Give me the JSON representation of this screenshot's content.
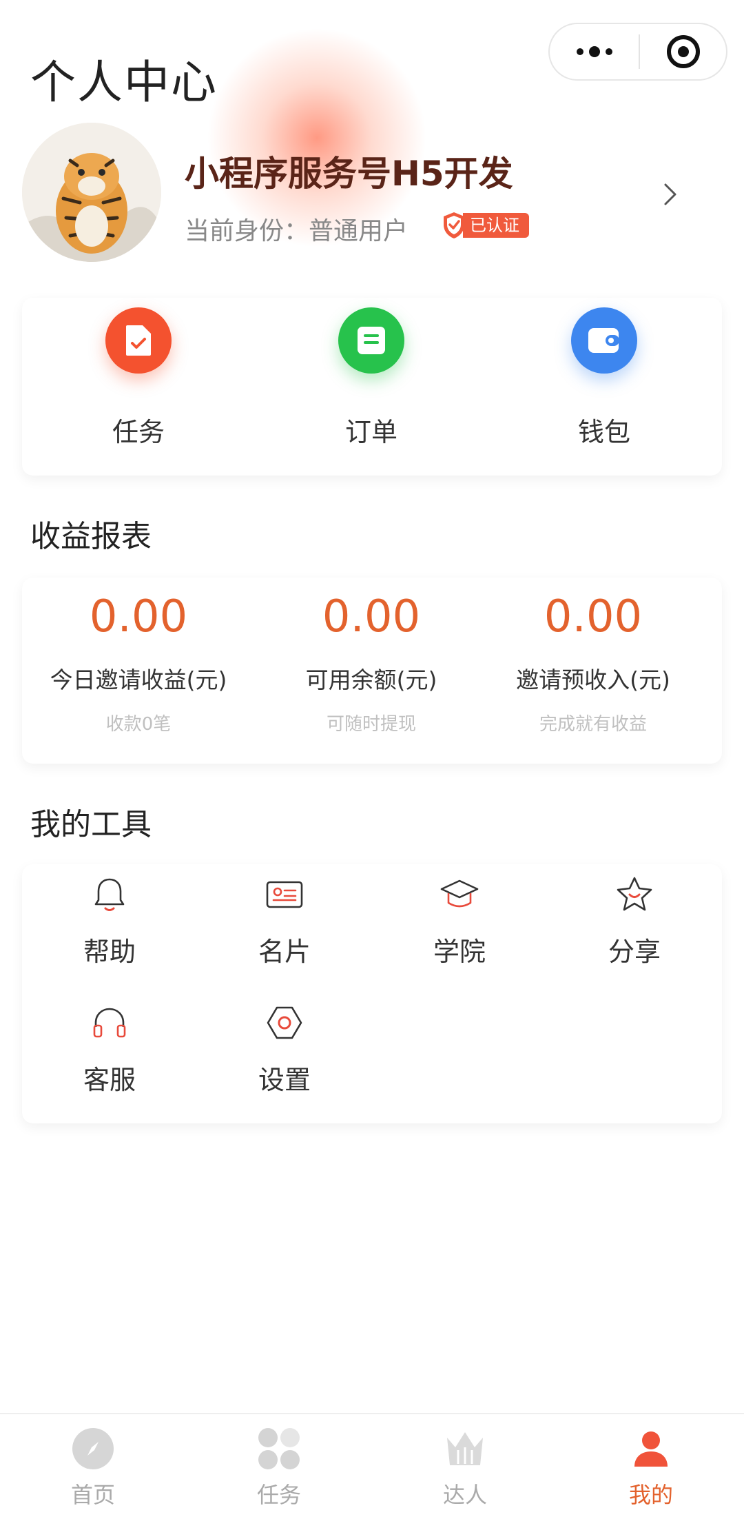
{
  "header": {
    "title": "个人中心"
  },
  "profile": {
    "name": "小程序服务号H5开发",
    "role": "当前身份：普通用户",
    "verified_label": "已认证"
  },
  "quick_actions": [
    {
      "label": "任务",
      "icon": "task-doc-icon",
      "color": "#f4522f"
    },
    {
      "label": "订单",
      "icon": "order-list-icon",
      "color": "#27c24c"
    },
    {
      "label": "钱包",
      "icon": "wallet-icon",
      "color": "#3d86ef"
    }
  ],
  "earnings": {
    "title": "收益报表",
    "items": [
      {
        "value": "0.00",
        "label": "今日邀请收益(元)",
        "sub": "收款0笔"
      },
      {
        "value": "0.00",
        "label": "可用余额(元)",
        "sub": "可随时提现"
      },
      {
        "value": "0.00",
        "label": "邀请预收入(元)",
        "sub": "完成就有收益"
      }
    ]
  },
  "tools": {
    "title": "我的工具",
    "items": [
      {
        "label": "帮助",
        "icon": "bell-icon"
      },
      {
        "label": "名片",
        "icon": "id-card-icon"
      },
      {
        "label": "学院",
        "icon": "graduation-cap-icon"
      },
      {
        "label": "分享",
        "icon": "star-icon"
      },
      {
        "label": "客服",
        "icon": "headphones-icon"
      },
      {
        "label": "设置",
        "icon": "settings-hexagon-icon"
      }
    ]
  },
  "tabbar": {
    "items": [
      {
        "label": "首页",
        "icon": "compass-icon",
        "active": false
      },
      {
        "label": "任务",
        "icon": "grid-icon",
        "active": false
      },
      {
        "label": "达人",
        "icon": "crown-icon",
        "active": false
      },
      {
        "label": "我的",
        "icon": "user-icon",
        "active": true
      }
    ]
  },
  "colors": {
    "accent": "#e3622d",
    "name": "#5a2418",
    "badge": "#f05a3c"
  }
}
